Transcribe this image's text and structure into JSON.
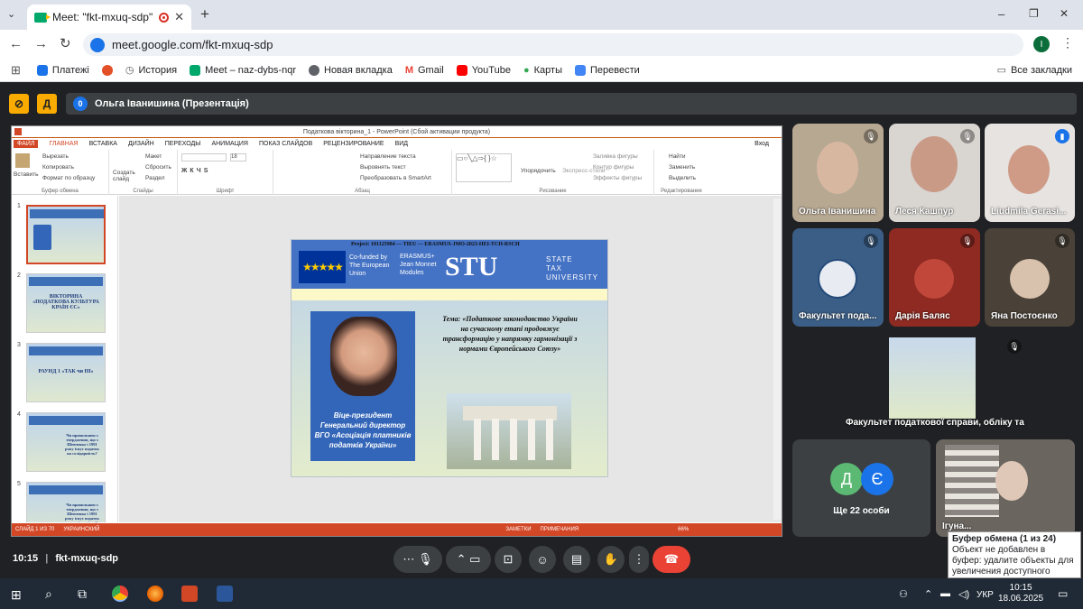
{
  "browser": {
    "tab_title": "Meet: \"fkt-mxuq-sdp\"",
    "new_tab": "+",
    "url": "meet.google.com/fkt-mxuq-sdp",
    "profile_letter": "I",
    "window_controls": [
      "–",
      "❐",
      "✕"
    ]
  },
  "bookmarks": {
    "items": [
      {
        "label": "Платежі",
        "color": "#1a73e8"
      },
      {
        "label": "",
        "color": "#e34f26"
      },
      {
        "label": "История",
        "color": "#5f6368"
      },
      {
        "label": "Meet – naz-dybs-nqr",
        "color": "#00a86b"
      },
      {
        "label": "Новая вкладка",
        "color": "#5f6368"
      },
      {
        "label": "Gmail",
        "color": "#ea4335"
      },
      {
        "label": "YouTube",
        "color": "#ff0000"
      },
      {
        "label": "Карты",
        "color": "#34a853"
      },
      {
        "label": "Перевести",
        "color": "#4285f4"
      }
    ],
    "all_bookmarks": "Все закладки"
  },
  "meet": {
    "presenter_count": "0",
    "presenter_label": "Ольга Іванишина (Презентація)",
    "meeting_time": "10:15",
    "meeting_code": "fkt-mxuq-sdp"
  },
  "ppt": {
    "window_title": "Податкова вікторина_1 - PowerPoint (Сбой активации продукта)",
    "tabs": [
      "ФАЙЛ",
      "ГЛАВНАЯ",
      "ВСТАВКА",
      "ДИЗАЙН",
      "ПЕРЕХОДЫ",
      "АНИМАЦИЯ",
      "ПОКАЗ СЛАЙДОВ",
      "РЕЦЕНЗИРОВАНИЕ",
      "ВИД"
    ],
    "login": "Вход",
    "ribbon": {
      "paste": "Вставить",
      "cut": "Вырезать",
      "copy": "Копировать",
      "format": "Формат по образцу",
      "g_clipboard": "Буфер обмена",
      "new_slide": "Создать слайд",
      "layout": "Макет",
      "reset": "Сбросить",
      "section": "Раздел",
      "g_slides": "Слайды",
      "font_size": "18",
      "g_font": "Шрифт",
      "text_dir": "Направление текста",
      "align_text": "Выровнять текст",
      "smartart": "Преобразовать в SmartArt",
      "g_paragraph": "Абзац",
      "arrange": "Упорядочить",
      "quick_styles": "Экспресс-стили",
      "shape_fill": "Заливка фигуры",
      "shape_outline": "Контур фигуры",
      "shape_effects": "Эффекты фигуры",
      "g_drawing": "Рисование",
      "find": "Найти",
      "replace": "Заменить",
      "select": "Выделить",
      "g_editing": "Редактирование"
    },
    "thumbs": [
      {
        "n": "1",
        "text": ""
      },
      {
        "n": "2",
        "text": "ВІКТОРИНА «ПОДАТКОВА КУЛЬТУРА КРАЇН ЄС»"
      },
      {
        "n": "3",
        "text": "РАУНД 1 «ТАК чи НІ»"
      },
      {
        "n": "4",
        "text": "Чи правильним є твердження, що з Шевченко і 1991 року існує податок на солідарність?"
      },
      {
        "n": "5",
        "text": "Чи правильним є твердження, що з Шевченко і 1991 року існує податок на солідарність?"
      }
    ],
    "slide": {
      "project": "Project: 101125984 — TIEU — ERASMUS-JMO-2023-HEI-TCH-RSCH",
      "cofunded": [
        "Co-funded by",
        "The European",
        "Union"
      ],
      "erasmus": [
        "ERASMUS+",
        "Jean Monnet",
        "Modules"
      ],
      "stu": "STU",
      "stu_full": [
        "STATE",
        "TAX",
        "UNIVERSITY"
      ],
      "eu_stars": "★★★★★",
      "theme": "Тема: «Податкове законодавство України на сучасному етапі продовжує трансформацію у напрямку гармонізації з нормами Європейського Союзу»",
      "person": "Віце-президент Генеральний директор ВГО «Асоціація платників податків України»"
    },
    "status": {
      "slide_of": "СЛАЙД 1 ИЗ 70",
      "lang": "УКРАИНСКИЙ",
      "notes": "ЗАМЕТКИ",
      "comments": "ПРИМЕЧАНИЯ",
      "zoom": "66%"
    }
  },
  "participants": [
    {
      "name": "Ольга Іванишина"
    },
    {
      "name": "Леся Кашпур"
    },
    {
      "name": "Liudmila Gerasi..."
    },
    {
      "name": "Факультет пода..."
    },
    {
      "name": "Дарія Баляс"
    },
    {
      "name": "Яна Постоєнко"
    },
    {
      "name": "Факультет податкової справи, обліку та ..."
    },
    {
      "name": "Ще 22 особи",
      "initials": [
        "Д",
        "Є"
      ]
    },
    {
      "name": "Ігуна..."
    }
  ],
  "toast": {
    "title": "Буфер обмена (1 из 24)",
    "body": "Объект не добавлен в буфер: удалите объекты для увеличения доступного места"
  },
  "taskbar": {
    "lang": "УКР",
    "time": "10:15",
    "date": "18.06.2025"
  }
}
